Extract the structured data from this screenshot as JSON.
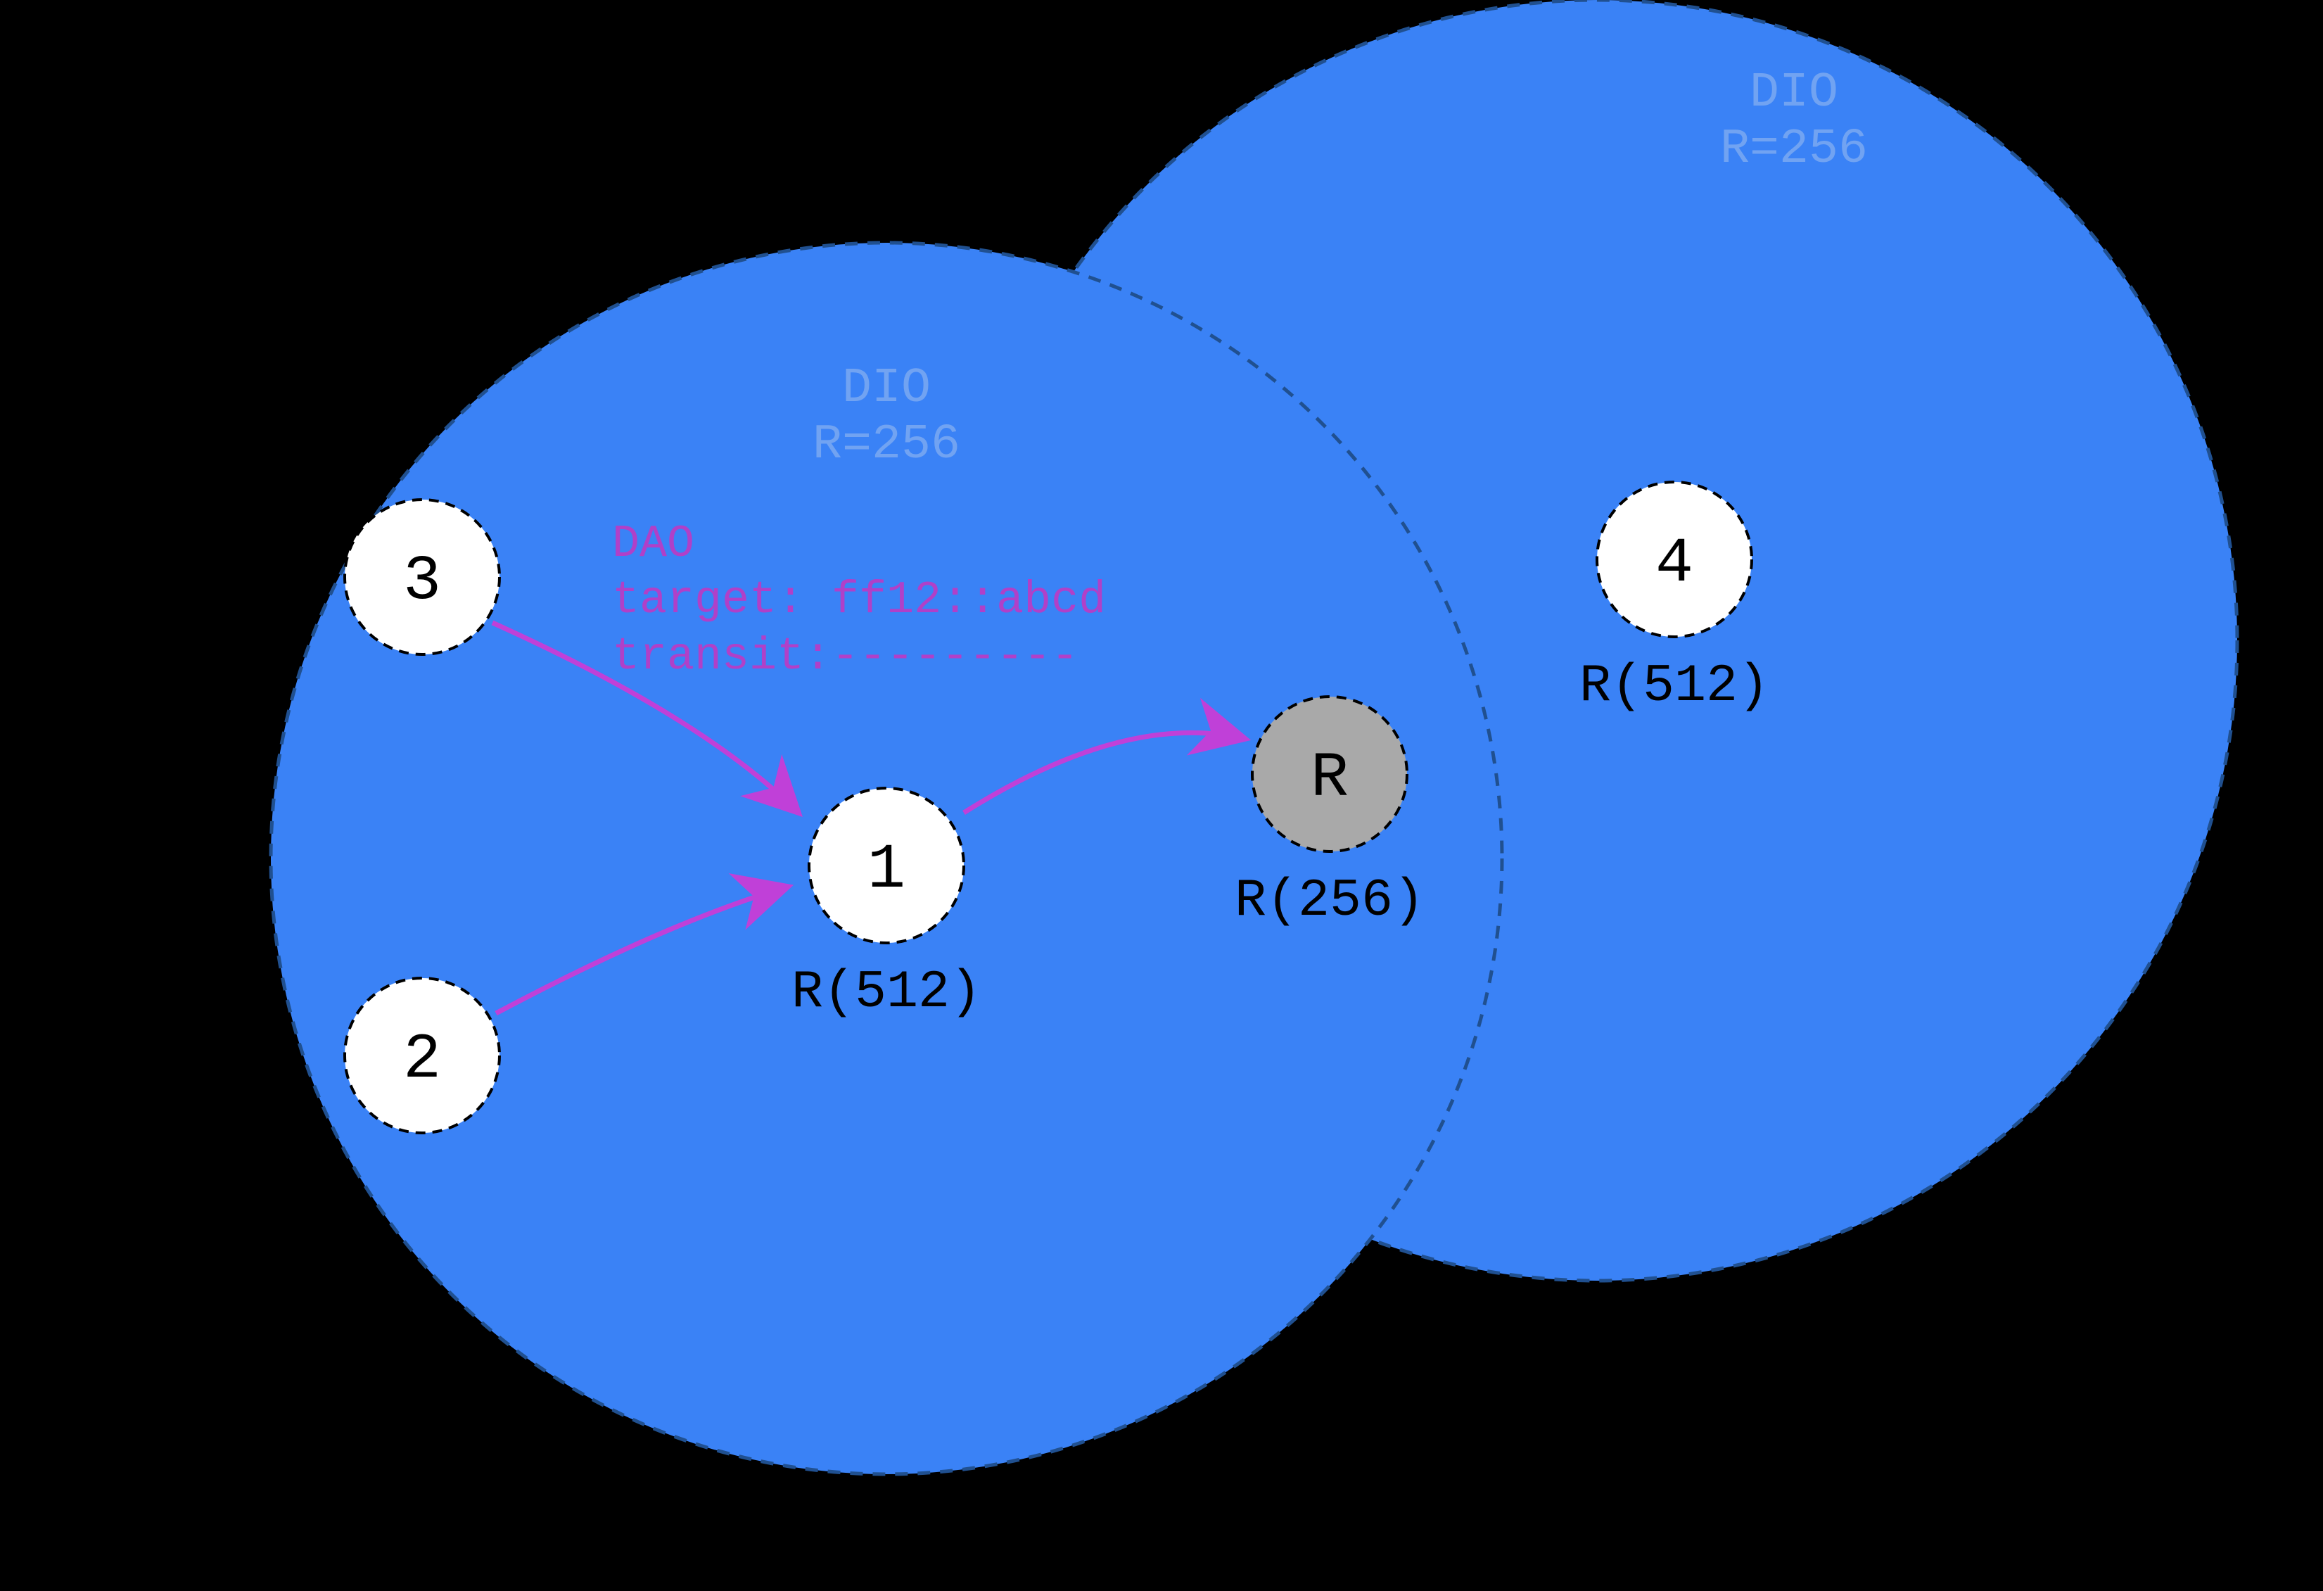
{
  "colors": {
    "background": "#000000",
    "region": "#3a82f6",
    "regionLabel": "#71a3f2",
    "nodeFill": "#ffffff",
    "rootFill": "#a9a9a9",
    "text": "#000000",
    "arrow": "#c040d8",
    "daoText": "#b040c8"
  },
  "regions": {
    "left": {
      "label": {
        "line1": "DIO",
        "line2": "R=256"
      }
    },
    "right": {
      "label": {
        "line1": "DIO",
        "line2": "R=256"
      }
    }
  },
  "nodes": {
    "n1": {
      "label": "1",
      "sub": "R(512)"
    },
    "n2": {
      "label": "2",
      "sub": ""
    },
    "n3": {
      "label": "3",
      "sub": ""
    },
    "n4": {
      "label": "4",
      "sub": "R(512)"
    },
    "root": {
      "label": "R",
      "sub": "R(256)"
    }
  },
  "dao": {
    "line1": "DAO",
    "line2": "target: ff12::abcd",
    "line3": "transit:---------"
  }
}
